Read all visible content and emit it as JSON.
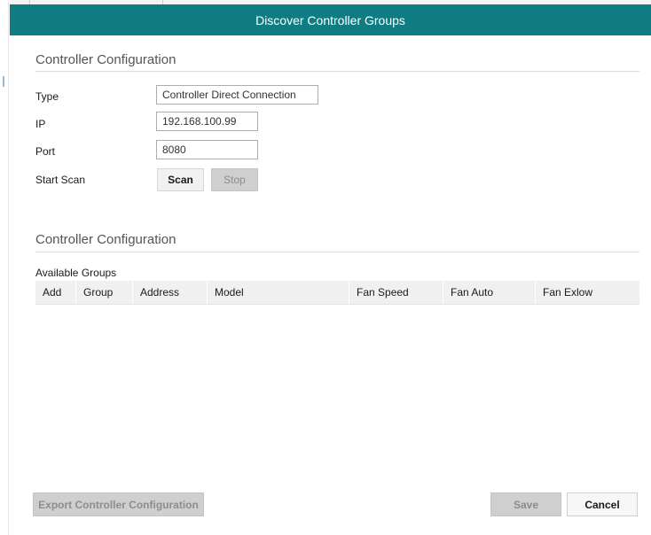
{
  "dialog": {
    "title": "Discover Controller Groups"
  },
  "connection_section": {
    "title": "Controller Configuration",
    "type": {
      "label": "Type",
      "value": "Controller Direct Connection"
    },
    "ip": {
      "label": "IP",
      "value": "192.168.100.99"
    },
    "port": {
      "label": "Port",
      "value": "8080"
    },
    "start_scan": {
      "label": "Start Scan",
      "scan_label": "Scan",
      "stop_label": "Stop"
    }
  },
  "groups_section": {
    "title": "Controller Configuration",
    "available_groups_label": "Available Groups",
    "columns": [
      "Add",
      "Group",
      "Address",
      "Model",
      "Fan Speed",
      "Fan Auto",
      "Fan Exlow"
    ],
    "rows": []
  },
  "footer": {
    "export_label": "Export Controller Configuration",
    "save_label": "Save",
    "cancel_label": "Cancel"
  },
  "colors": {
    "titlebar": "#0e7c80",
    "disabled_button": "#cfcfcf",
    "grid_header": "#f0f0f0"
  }
}
